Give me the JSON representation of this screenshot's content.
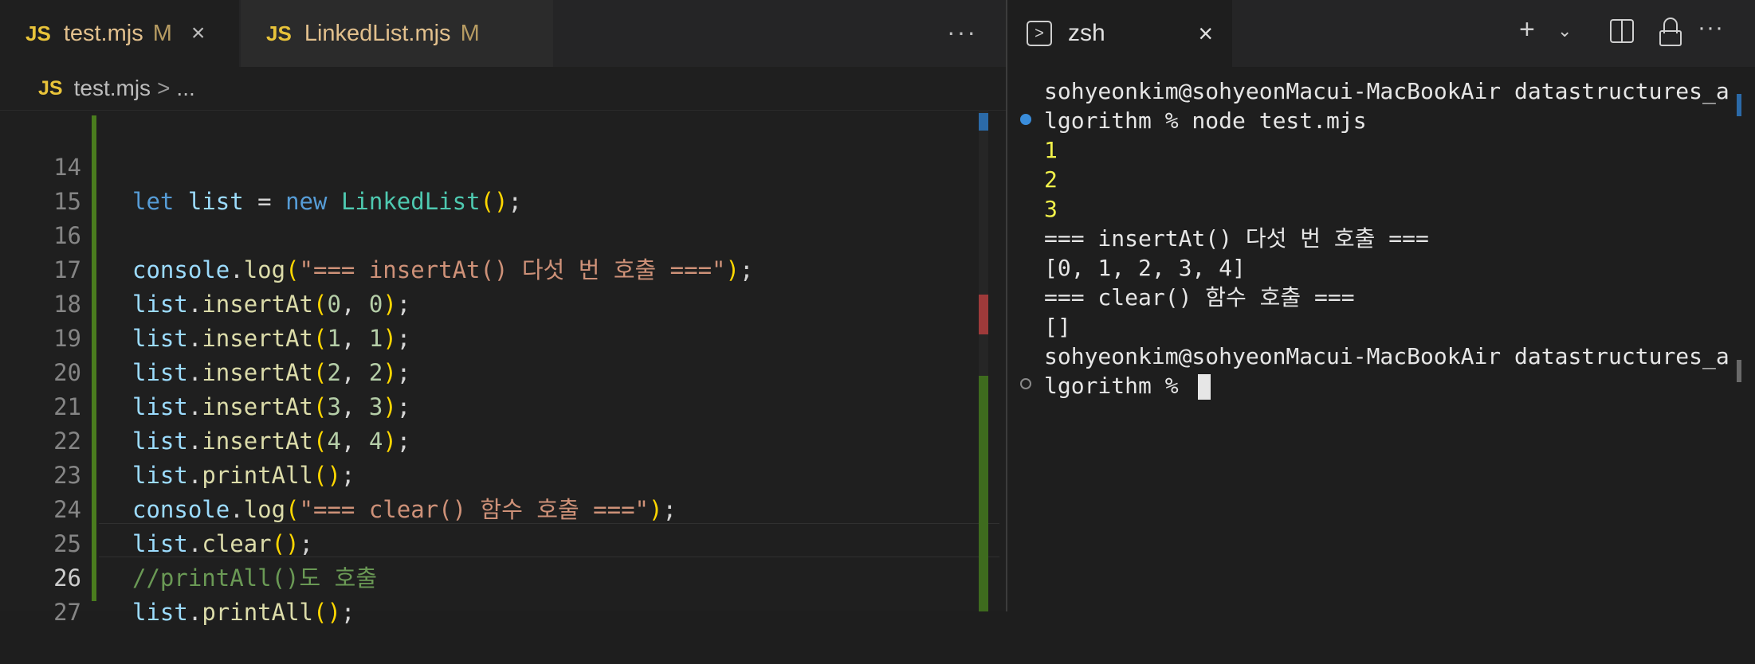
{
  "editor": {
    "tabs": [
      {
        "icon": "JS",
        "name": "test.mjs",
        "badge": "M",
        "close": "×"
      },
      {
        "icon": "JS",
        "name": "LinkedList.mjs",
        "badge": "M"
      }
    ],
    "more": "···",
    "breadcrumb": {
      "icon": "JS",
      "file": "test.mjs",
      "sep": ">",
      "rest": "..."
    },
    "lines": [
      {
        "num": "14"
      },
      {
        "num": "15"
      },
      {
        "num": "16"
      },
      {
        "num": "17"
      },
      {
        "num": "18"
      },
      {
        "num": "19"
      },
      {
        "num": "20"
      },
      {
        "num": "21"
      },
      {
        "num": "22"
      },
      {
        "num": "23"
      },
      {
        "num": "24"
      },
      {
        "num": "25"
      },
      {
        "num": "26"
      },
      {
        "num": "27"
      }
    ],
    "code": {
      "l14": {
        "kw": "let",
        "var": "list",
        "eq": " = ",
        "new": "new",
        "cls": "LinkedList",
        "tail": ";"
      },
      "l16": {
        "obj": "console",
        "fn": "log",
        "str": "\"=== insertAt() 다섯 번 호출 ===\""
      },
      "l17": {
        "args": [
          "0",
          "0"
        ]
      },
      "l18": {
        "args": [
          "1",
          "1"
        ]
      },
      "l19": {
        "args": [
          "2",
          "2"
        ]
      },
      "l20": {
        "args": [
          "3",
          "3"
        ]
      },
      "l21": {
        "args": [
          "4",
          "4"
        ]
      },
      "l22": {
        "fn": "printAll"
      },
      "l23": {
        "obj": "console",
        "fn": "log",
        "str": "\"=== clear() 함수 호출 ===\""
      },
      "l24": {
        "fn": "clear"
      },
      "l25": {
        "comment": "//printAll()도 호출"
      },
      "l26": {
        "fn": "printAll"
      },
      "var": "list",
      "insert_fn": "insertAt"
    }
  },
  "terminal": {
    "tab_label": "zsh",
    "close": "×",
    "lines": [
      "sohyeonkim@sohyeonMacui-MacBookAir datastructures_a",
      "lgorithm % node test.mjs",
      "1",
      "2",
      "3",
      "=== insertAt() 다섯 번 호출 ===",
      "[0, 1, 2, 3, 4]",
      "=== clear() 함수 호출 ===",
      "[]",
      "sohyeonkim@sohyeonMacui-MacBookAir datastructures_a",
      "lgorithm % "
    ]
  },
  "colors": {
    "keyword": "#569cd6",
    "variable": "#9cdcfe",
    "function": "#dcdcaa",
    "class": "#4ec9b0",
    "string": "#ce9178",
    "number": "#b5cea8",
    "bracket": "#ffd700",
    "comment": "#6a9955",
    "output_yellow": "#f1f14a"
  }
}
